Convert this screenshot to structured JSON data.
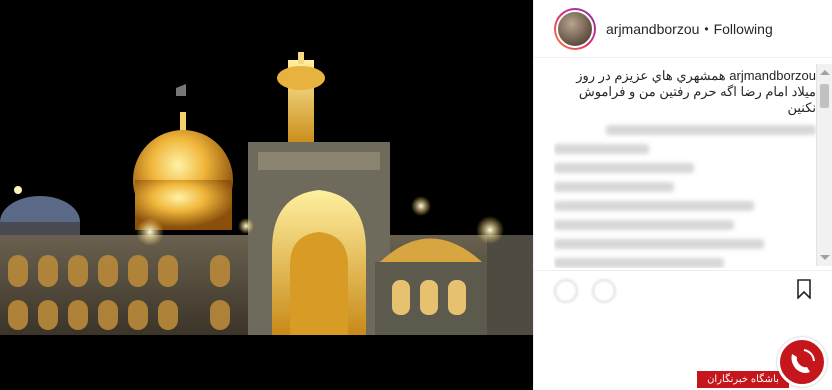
{
  "post": {
    "username": "arjmandborzou",
    "separator": "•",
    "follow_status": "Following"
  },
  "caption": {
    "username": "arjmandborzou",
    "text": "همشهري هاي عزيزم در روز ميلاد امام رضا اگه حرم رفتين من و فراموش نكنين"
  },
  "watermark": {
    "label": "باشگاه خبرنگاران"
  },
  "icons": {
    "like": "heart-icon",
    "comment": "comment-icon",
    "save": "bookmark-icon",
    "logo": "watermark-logo"
  },
  "colors": {
    "brand_red": "#c4161c",
    "gold": "#e9b94a"
  }
}
